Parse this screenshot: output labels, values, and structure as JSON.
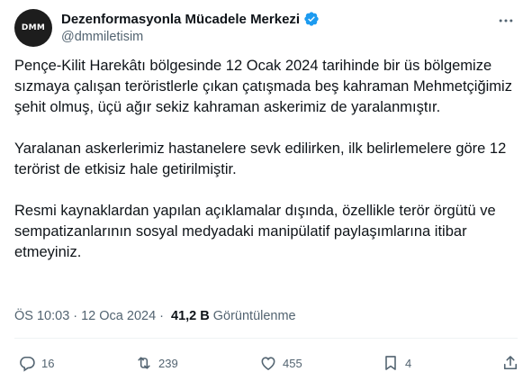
{
  "account": {
    "display_name": "Dezenformasyonla Mücadele Merkezi",
    "handle": "@dmmiletisim",
    "avatar_text": "DMM",
    "verified": true
  },
  "tweet": {
    "paragraphs": [
      "Pençe-Kilit Harekâtı bölgesinde 12 Ocak 2024 tarihinde bir üs bölgemize sızmaya çalışan teröristlerle çıkan çatışmada beş kahraman Mehmetçiğimiz şehit olmuş, üçü ağır sekiz kahraman askerimiz de yaralanmıştır.",
      "Yaralanan askerlerimiz hastanelere sevk edilirken, ilk belirlemelere göre 12 terörist de etkisiz hale getirilmiştir.",
      "Resmi kaynaklardan yapılan açıklamalar dışında, özellikle terör örgütü ve sempatizanlarının sosyal medyadaki manipülatif paylaşımlarına itibar etmeyiniz."
    ],
    "time": "ÖS 10:03",
    "separator": "·",
    "date": "12 Oca 2024",
    "views_count": "41,2 B",
    "views_label": "Görüntülenme"
  },
  "actions": {
    "replies": "16",
    "retweets": "239",
    "likes": "455",
    "bookmarks": "4"
  },
  "icons": {
    "verified": "verified-badge-icon",
    "more": "more-icon",
    "reply": "reply-icon",
    "retweet": "retweet-icon",
    "like": "heart-icon",
    "bookmark": "bookmark-icon",
    "share": "share-icon"
  },
  "colors": {
    "verified_blue": "#1d9bf0",
    "secondary_text": "#536471",
    "primary_text": "#0f1419"
  }
}
